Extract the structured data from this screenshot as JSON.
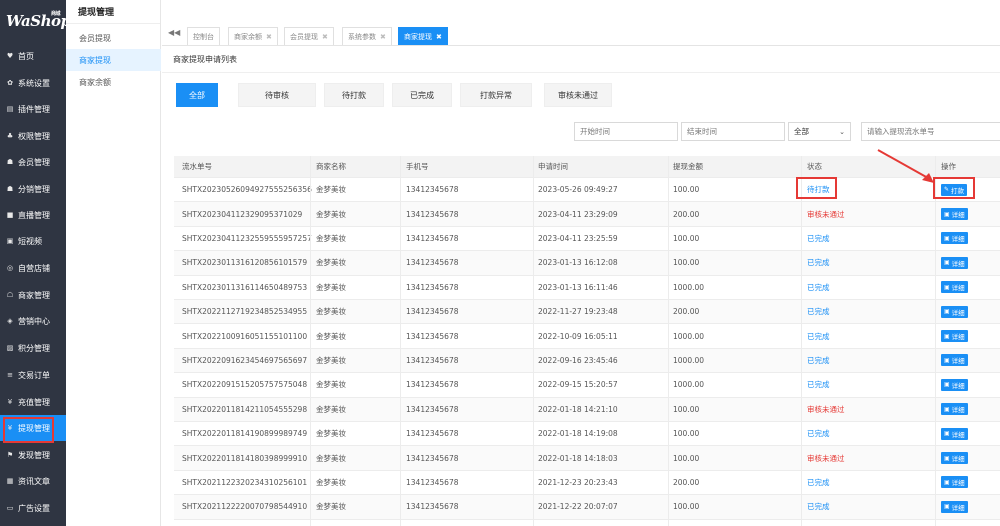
{
  "logo": {
    "text": "WaShop",
    "tag": "商城"
  },
  "sidebar": {
    "items": [
      {
        "label": "首页",
        "icon": "home-icon",
        "glyph": "♥"
      },
      {
        "label": "系统设置",
        "icon": "gear-icon",
        "glyph": "✿"
      },
      {
        "label": "插件管理",
        "icon": "plugin-icon",
        "glyph": "▤"
      },
      {
        "label": "权限管理",
        "icon": "sitemap-icon",
        "glyph": "♣"
      },
      {
        "label": "会员管理",
        "icon": "users-icon",
        "glyph": "☗"
      },
      {
        "label": "分销管理",
        "icon": "group-icon",
        "glyph": "☗"
      },
      {
        "label": "直播管理",
        "icon": "video-icon",
        "glyph": "■"
      },
      {
        "label": "短视频",
        "icon": "film-icon",
        "glyph": "▣"
      },
      {
        "label": "自营店铺",
        "icon": "shop-icon",
        "glyph": "◎"
      },
      {
        "label": "商家管理",
        "icon": "bank-icon",
        "glyph": "☖"
      },
      {
        "label": "营销中心",
        "icon": "compass-icon",
        "glyph": "◈"
      },
      {
        "label": "积分管理",
        "icon": "file-icon",
        "glyph": "▨"
      },
      {
        "label": "交易订单",
        "icon": "sliders-icon",
        "glyph": "≡"
      },
      {
        "label": "充值管理",
        "icon": "yen-icon",
        "glyph": "¥"
      },
      {
        "label": "提现管理",
        "icon": "yen-icon",
        "glyph": "¥"
      },
      {
        "label": "发现管理",
        "icon": "flag-icon",
        "glyph": "⚑"
      },
      {
        "label": "资讯文章",
        "icon": "newspaper-icon",
        "glyph": "▦"
      },
      {
        "label": "广告设置",
        "icon": "image-icon",
        "glyph": "▭"
      }
    ]
  },
  "subpanel": {
    "title": "提现管理",
    "items": [
      "会员提现",
      "商家提现",
      "商家余额"
    ]
  },
  "tabs": [
    {
      "label": "控制台",
      "close": ""
    },
    {
      "label": "商家余额",
      "close": "✖"
    },
    {
      "label": "会员提现",
      "close": "✖"
    },
    {
      "label": "系统参数",
      "close": "✖"
    },
    {
      "label": "商家提现",
      "close": "✖"
    }
  ],
  "nav_back": "◀◀",
  "page_title": "商家提现申请列表",
  "filters": [
    "全部",
    "待审核",
    "待打款",
    "已完成",
    "打款异常",
    "审核未通过"
  ],
  "search": {
    "start_placeholder": "开始时间",
    "end_placeholder": "结束时间",
    "status_select": "全部",
    "serial_placeholder": "请输入提现流水单号"
  },
  "table": {
    "headers": [
      "流水单号",
      "商家名称",
      "手机号",
      "申请时间",
      "提现金额",
      "状态",
      "操作"
    ],
    "rows": [
      {
        "serial": "SHTX20230526094927555256356",
        "merchant": "金梦美妆",
        "phone": "13412345678",
        "time": "2023-05-26 09:49:27",
        "amount": "100.00",
        "status": "待打款",
        "status_type": "pending",
        "action": "打款"
      },
      {
        "serial": "SHTX20230411232909537102​9",
        "merchant": "金梦美妆",
        "phone": "13412345678",
        "time": "2023-04-11 23:29:09",
        "amount": "200.00",
        "status": "审核未通过",
        "status_type": "reject",
        "action": "详细"
      },
      {
        "serial": "SHTX20230411232559555957257",
        "merchant": "金梦美妆",
        "phone": "13412345678",
        "time": "2023-04-11 23:25:59",
        "amount": "100.00",
        "status": "已完成",
        "status_type": "done",
        "action": "详细"
      },
      {
        "serial": "SHTX20230113161208561015​79",
        "merchant": "金梦美妆",
        "phone": "13412345678",
        "time": "2023-01-13 16:12:08",
        "amount": "100.00",
        "status": "已完成",
        "status_type": "done",
        "action": "详细"
      },
      {
        "serial": "SHTX20230113161146504897​53",
        "merchant": "金梦美妆",
        "phone": "13412345678",
        "time": "2023-01-13 16:11:46",
        "amount": "1000.00",
        "status": "已完成",
        "status_type": "done",
        "action": "详细"
      },
      {
        "serial": "SHTX20221127192348525349​55",
        "merchant": "金梦美妆",
        "phone": "13412345678",
        "time": "2022-11-27 19:23:48",
        "amount": "200.00",
        "status": "已完成",
        "status_type": "done",
        "action": "详细"
      },
      {
        "serial": "SHTX20221009160511551011​00",
        "merchant": "金梦美妆",
        "phone": "13412345678",
        "time": "2022-10-09 16:05:11",
        "amount": "1000.00",
        "status": "已完成",
        "status_type": "done",
        "action": "详细"
      },
      {
        "serial": "SHTX20220916234546975656​97",
        "merchant": "金梦美妆",
        "phone": "13412345678",
        "time": "2022-09-16 23:45:46",
        "amount": "1000.00",
        "status": "已完成",
        "status_type": "done",
        "action": "详细"
      },
      {
        "serial": "SHTX20220915152057575750​48",
        "merchant": "金梦美妆",
        "phone": "13412345678",
        "time": "2022-09-15 15:20:57",
        "amount": "1000.00",
        "status": "已完成",
        "status_type": "done",
        "action": "详细"
      },
      {
        "serial": "SHTX20220118142110545552​98",
        "merchant": "金梦美妆",
        "phone": "13412345678",
        "time": "2022-01-18 14:21:10",
        "amount": "100.00",
        "status": "审核未通过",
        "status_type": "reject",
        "action": "详细"
      },
      {
        "serial": "SHTX20220118141908999897​49",
        "merchant": "金梦美妆",
        "phone": "13412345678",
        "time": "2022-01-18 14:19:08",
        "amount": "100.00",
        "status": "已完成",
        "status_type": "done",
        "action": "详细"
      },
      {
        "serial": "SHTX20220118141803989999​10",
        "merchant": "金梦美妆",
        "phone": "13412345678",
        "time": "2022-01-18 14:18:03",
        "amount": "100.00",
        "status": "审核未通过",
        "status_type": "reject",
        "action": "详细"
      },
      {
        "serial": "SHTX20211223202343102561​01",
        "merchant": "金梦美妆",
        "phone": "13412345678",
        "time": "2021-12-23 20:23:43",
        "amount": "200.00",
        "status": "已完成",
        "status_type": "done",
        "action": "详细"
      },
      {
        "serial": "SHTX20211222200707985449​10",
        "merchant": "金梦美妆",
        "phone": "13412345678",
        "time": "2021-12-22 20:07:07",
        "amount": "100.00",
        "status": "已完成",
        "status_type": "done",
        "action": "详细"
      }
    ]
  },
  "colors": {
    "accent": "#1a8ff5",
    "sidebar_bg": "#2f3542",
    "reject": "#e53935",
    "highlight": "#e53935"
  }
}
